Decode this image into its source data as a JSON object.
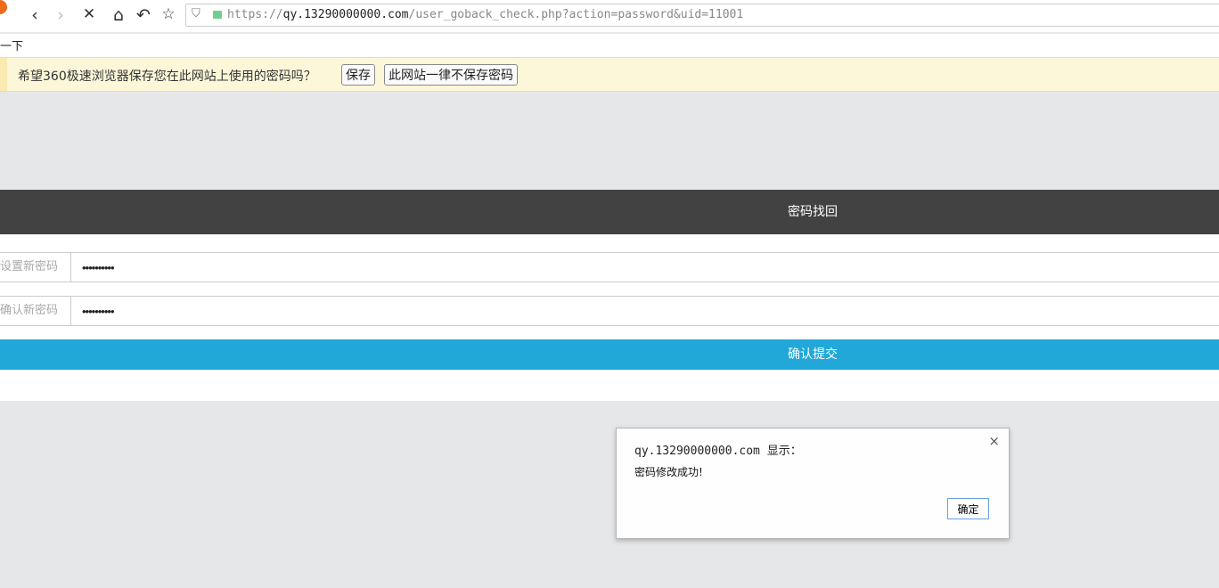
{
  "browser": {
    "url_prefix": "https://",
    "url_host": "qy.13290000000.com",
    "url_path": "/user_goback_check.php?action=password&uid=11001",
    "icons": {
      "back": "‹",
      "forward": "›",
      "stop": "✕",
      "home": "⌂",
      "reload": "↶",
      "favorite": "☆",
      "shield": "⛉"
    },
    "bookmark_text": "一下"
  },
  "password_bar": {
    "message": "希望360极速浏览器保存您在此网站上使用的密码吗？",
    "save_label": "保存",
    "never_label": "此网站一律不保存密码"
  },
  "page": {
    "title": "密码找回",
    "new_password_label": "设置新密码",
    "new_password_value": "••••••••••",
    "confirm_password_label": "确认新密码",
    "confirm_password_value": "••••••••••",
    "submit_label": "确认提交"
  },
  "dialog": {
    "title": "qy.13290000000.com 显示：",
    "message": "密码修改成功!",
    "ok_label": "确定",
    "close": "×"
  }
}
